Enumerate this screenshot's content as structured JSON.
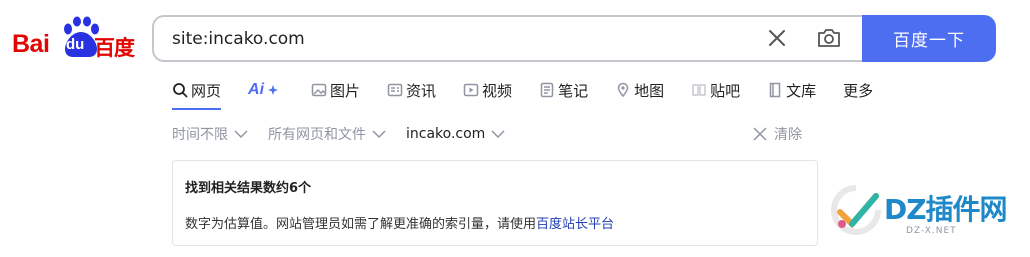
{
  "logo": {
    "bai": "Bai",
    "du": "du",
    "cn": "百度"
  },
  "search": {
    "query": "site:incako.com",
    "button_label": "百度一下"
  },
  "tabs": [
    {
      "label": "网页",
      "icon": "search-icon",
      "active": true
    },
    {
      "label": "Ai",
      "icon": "ai-icon",
      "active": false
    },
    {
      "label": "图片",
      "icon": "image-icon",
      "active": false
    },
    {
      "label": "资讯",
      "icon": "news-icon",
      "active": false
    },
    {
      "label": "视频",
      "icon": "video-icon",
      "active": false
    },
    {
      "label": "笔记",
      "icon": "note-icon",
      "active": false
    },
    {
      "label": "地图",
      "icon": "map-icon",
      "active": false
    },
    {
      "label": "贴吧",
      "icon": "tieba-icon",
      "active": false
    },
    {
      "label": "文库",
      "icon": "wenku-icon",
      "active": false
    },
    {
      "label": "更多",
      "icon": "",
      "active": false
    }
  ],
  "filters": {
    "time": "时间不限",
    "type": "所有网页和文件",
    "site": "incako.com",
    "clear": "清除"
  },
  "result": {
    "count_text": "找到相关结果数约6个",
    "note_text": "数字为估算值。网站管理员如需了解更准确的索引量，请使用",
    "note_link": "百度站长平台"
  },
  "watermark": {
    "text": "DZ插件网",
    "url": "DZ-X.NET"
  },
  "colors": {
    "accent": "#4e6ef2",
    "brand_red": "#e10601",
    "link": "#2440b3",
    "muted": "#9195a3"
  }
}
